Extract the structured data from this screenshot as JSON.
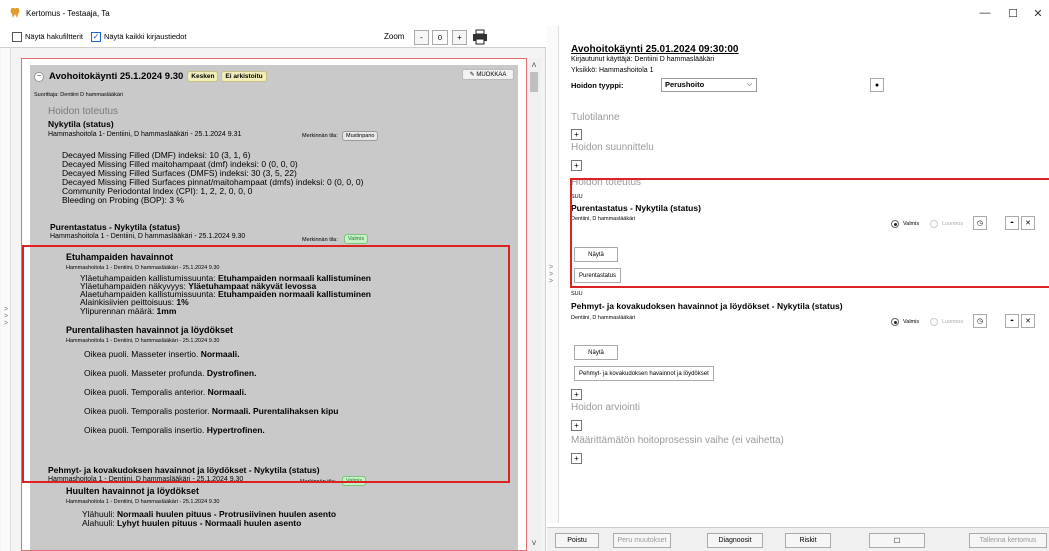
{
  "window": {
    "title": "Kertomus - Testaaja, Ta",
    "minimize": "—",
    "maximize": "☐",
    "close": "✕"
  },
  "toolbar": {
    "show_filters": "Näytä hakufiltterit",
    "show_all": "Näytä kaikki kirjaustiedot",
    "zoom_label": "Zoom",
    "zoom_minus": "-",
    "zoom_value": "0",
    "zoom_plus": "+"
  },
  "left": {
    "entry_title": "Avohoitokäynti 25.1.2024 9.30",
    "badge_kesken": "Kesken",
    "badge_arkisto": "Ei arkistoitu",
    "edit_button": "✎ MUOKKAA",
    "suorittaja": "Suorittaja: Dentiini D hammaslääkäri",
    "hoidon_toteutus": "Hoidon toteutus",
    "nykytila_title": "Nykytila (status)",
    "nykytila_meta": "Hammashoitola 1- Dentiini, D hammaslääkäri - 25.1.2024 9.31",
    "merkinnan_tila": "Merkinnän tila:",
    "tag_musta": "Mustinpano",
    "dmf_lines": [
      "Decayed Missing Filled (DMF) indeksi: 10 (3, 1, 6)",
      "Decayed Missing Filled maitohampaat (dmf) indeksi: 0 (0, 0, 0)",
      "Decayed Missing Filled Surfaces (DMFS) indeksi: 30 (3, 5, 22)",
      "Decayed Missing Filled Surfaces pinnat/maitohampaat (dmfs) indeksi: 0 (0, 0, 0)",
      "Community Periodontal Index (CPI): 1, 2, 2, 0, 0, 0",
      "Bleeding on Probing (BOP): 3 %"
    ],
    "purenta_title": "Purentastatus - Nykytila (status)",
    "purenta_meta": "Hammashoitola 1 - Dentiini, D hammaslääkäri - 25.1.2024 9.30",
    "tag_valmis": "Valmis",
    "etuham_title": "Etuhampaiden havainnot",
    "etuham_meta": "Hammashoitola 1 - Dentiini, D hammaslääkäri - 25.1.2024 9.30",
    "etuham_lines": [
      {
        "label": "Yläetuhampaiden kallistumissuunta: ",
        "value": "Etuhampaiden normaali kallistuminen"
      },
      {
        "label": "Yläetuhampaiden näkyvyys: ",
        "value": "Yläetuhampaat näkyvät levossa"
      },
      {
        "label": "Alaetuhampaiden kallistumissuunta: ",
        "value": "Etuhampaiden normaali kallistuminen"
      },
      {
        "label": "Alainkisiivien peittoisuus: ",
        "value": "1%"
      },
      {
        "label": "Ylipurennan määrä: ",
        "value": "1mm"
      }
    ],
    "puren_title": "Purentalihasten havainnot ja löydökset",
    "puren_meta": "Hammashoitola 1 - Dentiini, D hammaslääkäri - 25.1.2024 9.30",
    "puren_lines": [
      {
        "label": "Oikea puoli. Masseter insertio. ",
        "value": "Normaali."
      },
      {
        "label": "Oikea puoli. Masseter profunda. ",
        "value": "Dystrofinen."
      },
      {
        "label": "Oikea puoli. Temporalis anterior. ",
        "value": "Normaali."
      },
      {
        "label": "Oikea puoli. Temporalis posterior. ",
        "value": "Normaali. Purentalihaksen kipu"
      },
      {
        "label": "Oikea puoli. Temporalis insertio. ",
        "value": "Hypertrofinen."
      }
    ],
    "pehmyt_title": "Pehmyt- ja kovakudoksen havainnot ja löydökset - Nykytila (status)",
    "pehmyt_meta": "Hammashoitola 1 - Dentiini, D hammaslääkäri - 25.1.2024 9.30",
    "huulet_title": "Huulten havainnot ja löydökset",
    "huulet_meta": "Hammashoitola 1 - Dentiini, D hammaslääkäri - 25.1.2024 9.30",
    "huulet_lines": [
      {
        "label": "Ylähuuli: ",
        "value": "Normaali huulen pituus - Protrusiivinen huulen asento"
      },
      {
        "label": "Alahuuli: ",
        "value": "Lyhyt huulen pituus - Normaali huulen asento"
      }
    ]
  },
  "right": {
    "header_title": "Avohoitokäynti 25.01.2024 09:30:00",
    "kirjautunut": "Kirjautunut käyttäjä: Dentiini D hammaslääkäri",
    "yksikko": "Yksikkö: Hammashoitola 1",
    "hoidon_tyyppi_label": "Hoidon tyyppi:",
    "hoidon_tyyppi_value": "Perushoito",
    "tulotilanne": "Tulotilanne",
    "hoidon_suunnittelu": "Hoidon suunnittelu",
    "hoidon_toteutus": "Hoidon toteutus",
    "suu1": "SUU",
    "purenta_title": "Purentastatus - Nykytila (status)",
    "author1": "Dentiini, D hammaslääkäri",
    "valmis": "Valmis",
    "luonnos": "Luonnos",
    "nayta": "Näytä",
    "purenta_button": "Purentastatus",
    "suu2": "SUU",
    "pehmyt_title": "Pehmyt- ja kovakudoksen havainnot ja löydökset - Nykytila (status)",
    "author2": "Dentiini, D hammaslääkäri",
    "pehmyt_button": "Pehmyt- ja kovakudoksen havainnot ja löydökset",
    "hoidon_arviointi": "Hoidon arviointi",
    "maarittamaton": "Määrittämätön hoitoprosessin vaihe (ei vaihetta)",
    "plus": "+",
    "bottom": {
      "poistu": "Poistu",
      "peru": "Peru muutokset",
      "diagnoosit": "Diagnoosit",
      "riskit": "Riskit",
      "tallenna": "Tallenna kertomus"
    }
  }
}
